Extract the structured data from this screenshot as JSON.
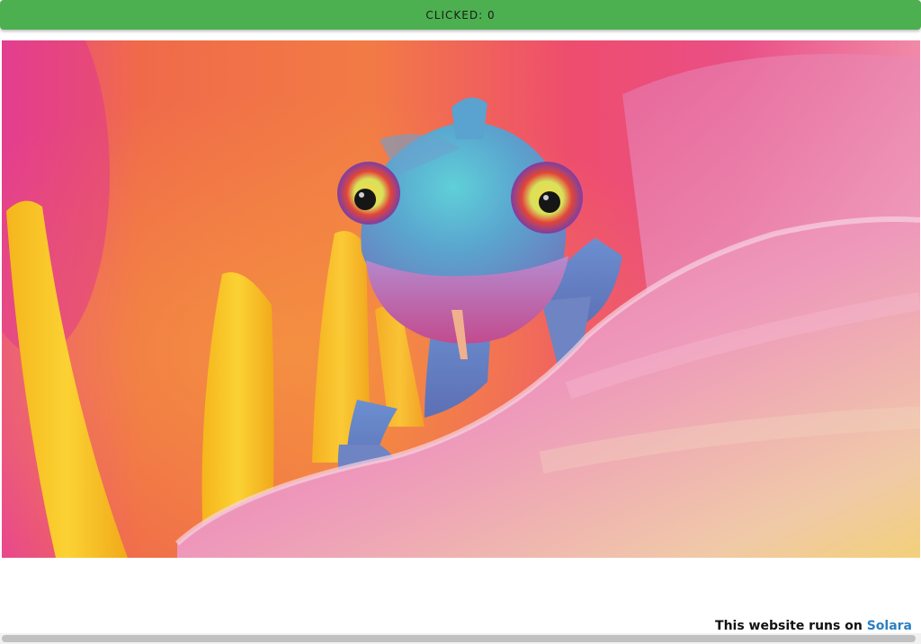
{
  "button": {
    "label": "CLICKED: 0",
    "color": "#4caf50"
  },
  "image": {
    "subject": "chameleon-on-flower-petal"
  },
  "footer": {
    "prefix": "This website runs on",
    "link_text": "Solara",
    "link_color": "#2d7fc0"
  }
}
